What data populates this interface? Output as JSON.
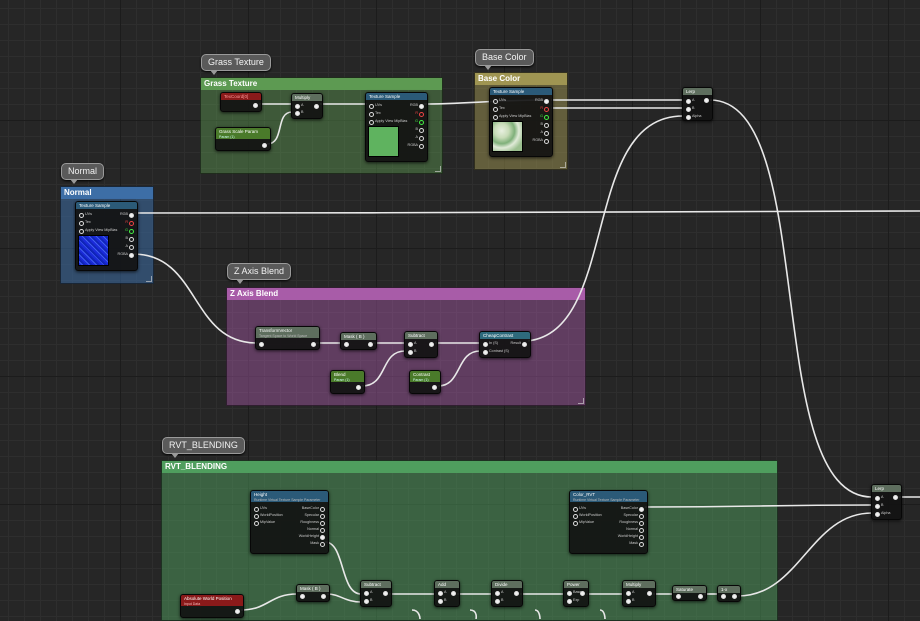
{
  "comments": {
    "grass": {
      "bubble": "Grass Texture",
      "title": "Grass Texture",
      "color": "#5d9a52"
    },
    "base": {
      "bubble": "Base Color",
      "title": "Base Color",
      "color": "#9f9552"
    },
    "normal": {
      "bubble": "Normal",
      "title": "Normal",
      "color": "#3d6ea6"
    },
    "zaxis": {
      "bubble": "Z Axis Blend",
      "title": "Z Axis Blend",
      "color": "#a85ca8"
    },
    "rvt": {
      "bubble": "RVT_BLENDING",
      "title": "RVT_BLENDING",
      "color": "#4f9e5e"
    }
  },
  "nodes": {
    "texcoord": {
      "title": "TexCoord[0]"
    },
    "multiply1": {
      "title": "Multiply",
      "a": "A",
      "b": "B"
    },
    "grass_scale": {
      "title": "Grass Scale Param",
      "sub": "Param (1)"
    },
    "ts_grass": {
      "title": "Texture Sample",
      "inputs": [
        "UVs",
        "Tex",
        "Apply View MipBias"
      ],
      "outputs": [
        "RGB",
        "R",
        "G",
        "B",
        "A",
        "RGBA"
      ]
    },
    "ts_base": {
      "title": "Texture Sample",
      "inputs": [
        "UVs",
        "Tex",
        "Apply View MipBias"
      ],
      "outputs": [
        "RGB",
        "R",
        "G",
        "B",
        "A",
        "RGBA"
      ]
    },
    "ts_normal": {
      "title": "Texture Sample",
      "inputs": [
        "UVs",
        "Tex",
        "Apply View MipBias"
      ],
      "outputs": [
        "RGB",
        "R",
        "G",
        "B",
        "A",
        "RGBA"
      ]
    },
    "lerp1": {
      "title": "Lerp",
      "inputs": [
        "A",
        "B",
        "Alpha"
      ]
    },
    "lerp2": {
      "title": "Lerp",
      "inputs": [
        "A",
        "B",
        "Alpha"
      ]
    },
    "transform": {
      "title": "TransformVector",
      "sub": "Tangent Space to World Space"
    },
    "mask_b": {
      "title": "Mask ( B )"
    },
    "subtract1": {
      "title": "Subtract",
      "a": "A",
      "b": "B"
    },
    "cheap_contrast": {
      "title": "CheapContrast",
      "in1": "In (S)",
      "in2": "Contrast (S)",
      "out": "Result"
    },
    "blend": {
      "title": "Blend",
      "sub": "Param (1)"
    },
    "contrast": {
      "title": "Contrast",
      "sub": "Param (1)"
    },
    "height": {
      "title": "Height",
      "sub": "Runtime Virtual Texture Sample Parameter",
      "inputs": [
        "UVs",
        "WorldPosition",
        "MipValue"
      ],
      "outputs": [
        "BaseColor",
        "Specular",
        "Roughness",
        "Normal",
        "WorldHeight",
        "Mask"
      ]
    },
    "color_rvt": {
      "title": "Color_RVT",
      "sub": "Runtime Virtual Texture Sample Parameter",
      "inputs": [
        "UVs",
        "WorldPosition",
        "MipValue"
      ],
      "outputs": [
        "BaseColor",
        "Specular",
        "Roughness",
        "Normal",
        "WorldHeight",
        "Mask"
      ]
    },
    "abs_world": {
      "title": "Absolute World Position",
      "sub": "Input Data"
    },
    "mask_b2": {
      "title": "Mask ( B )"
    },
    "subtract2": {
      "title": "Subtract",
      "a": "A",
      "b": "B"
    },
    "add": {
      "title": "Add",
      "a": "A",
      "b": "B"
    },
    "divide": {
      "title": "Divide",
      "a": "A",
      "b": "B"
    },
    "power": {
      "title": "Power",
      "a": "Base",
      "b": "Exp"
    },
    "multiply2": {
      "title": "Multiply",
      "a": "A",
      "b": "B"
    },
    "saturate": {
      "title": "Saturate"
    },
    "oneminus": {
      "title": "1-x"
    }
  },
  "colors": {
    "param": "#4a7a2a",
    "texture": "#2b5a78",
    "math": "#5e6e5e",
    "function": "#2e6a7c",
    "world": "#8a1a1a"
  }
}
